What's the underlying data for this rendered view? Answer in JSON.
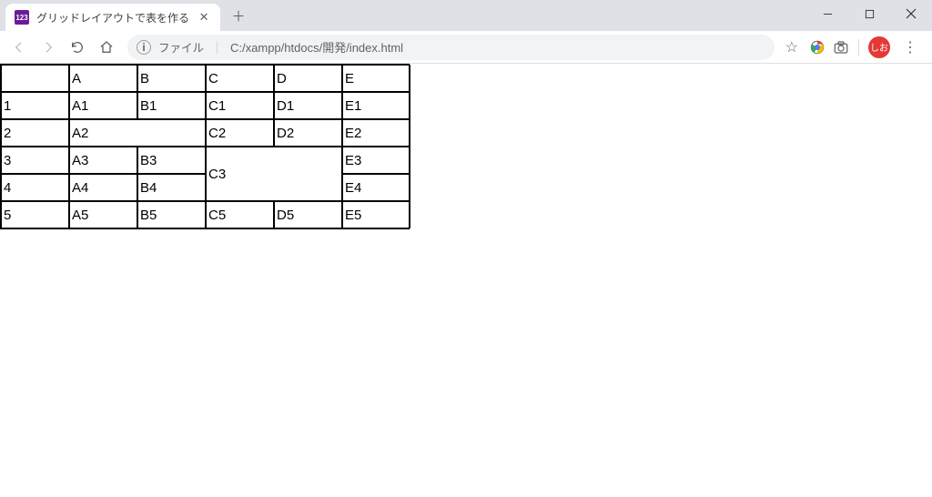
{
  "window": {
    "tab_title": "グリッドレイアウトで表を作る",
    "favicon_text": "123"
  },
  "toolbar": {
    "file_label": "ファイル",
    "url": "C:/xampp/htdocs/開発/index.html",
    "avatar_text": "しお"
  },
  "grid": {
    "cells": [
      {
        "v": "",
        "cls": ""
      },
      {
        "v": "A",
        "cls": ""
      },
      {
        "v": "B",
        "cls": ""
      },
      {
        "v": "C",
        "cls": ""
      },
      {
        "v": "D",
        "cls": ""
      },
      {
        "v": "E",
        "cls": ""
      },
      {
        "v": "1",
        "cls": ""
      },
      {
        "v": "A1",
        "cls": ""
      },
      {
        "v": "B1",
        "cls": ""
      },
      {
        "v": "C1",
        "cls": ""
      },
      {
        "v": "D1",
        "cls": ""
      },
      {
        "v": "E1",
        "cls": ""
      },
      {
        "v": "2",
        "cls": ""
      },
      {
        "v": "A2",
        "cls": "span-col2"
      },
      {
        "v": "C2",
        "cls": ""
      },
      {
        "v": "D2",
        "cls": ""
      },
      {
        "v": "E2",
        "cls": ""
      },
      {
        "v": "3",
        "cls": ""
      },
      {
        "v": "A3",
        "cls": ""
      },
      {
        "v": "B3",
        "cls": ""
      },
      {
        "v": "C3",
        "cls": "span-rc2"
      },
      {
        "v": "E3",
        "cls": ""
      },
      {
        "v": "4",
        "cls": ""
      },
      {
        "v": "A4",
        "cls": ""
      },
      {
        "v": "B4",
        "cls": ""
      },
      {
        "v": "E4",
        "cls": ""
      },
      {
        "v": "5",
        "cls": ""
      },
      {
        "v": "A5",
        "cls": ""
      },
      {
        "v": "B5",
        "cls": ""
      },
      {
        "v": "C5",
        "cls": ""
      },
      {
        "v": "D5",
        "cls": ""
      },
      {
        "v": "E5",
        "cls": ""
      }
    ]
  }
}
